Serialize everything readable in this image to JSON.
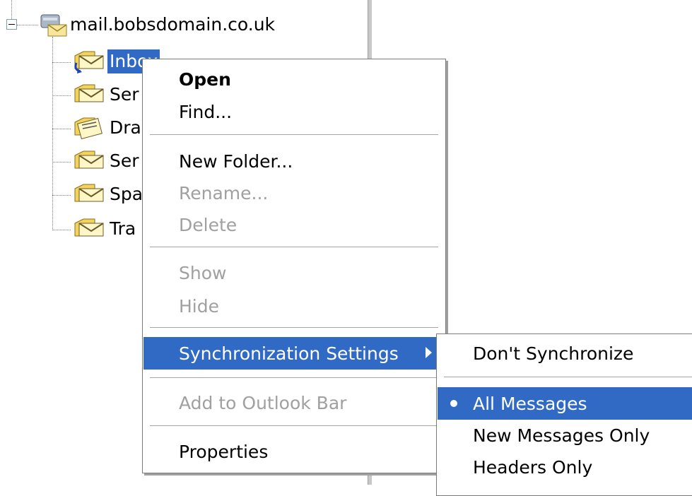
{
  "tree": {
    "account": "mail.bobsdomain.co.uk",
    "folders": [
      {
        "label": "Inbox",
        "icon": "inbox-folder-icon"
      },
      {
        "label": "Ser",
        "icon": "sent-folder-icon"
      },
      {
        "label": "Dra",
        "icon": "drafts-folder-icon"
      },
      {
        "label": "Ser",
        "icon": "folder-icon"
      },
      {
        "label": "Spa",
        "icon": "folder-icon"
      },
      {
        "label": "Tra",
        "icon": "folder-icon"
      }
    ]
  },
  "context_menu": {
    "open": "Open",
    "find": "Find...",
    "new_folder": "New Folder...",
    "rename": "Rename...",
    "delete": "Delete",
    "show": "Show",
    "hide": "Hide",
    "sync_settings": "Synchronization Settings",
    "add_to_bar": "Add to Outlook Bar",
    "properties": "Properties"
  },
  "sync_submenu": {
    "dont_sync": "Don't Synchronize",
    "all_messages": "All Messages",
    "new_only": "New Messages Only",
    "headers_only": "Headers Only",
    "selected": "All Messages"
  },
  "colors": {
    "highlight": "#316ac5",
    "disabled_text": "#a0a0a0"
  }
}
